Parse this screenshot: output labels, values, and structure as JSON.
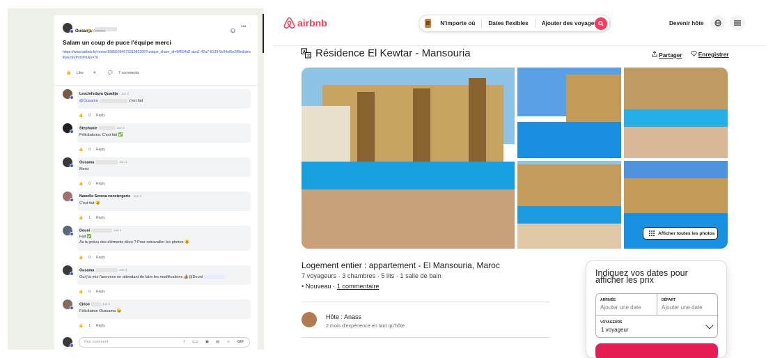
{
  "left": {
    "post": {
      "author": "Ousama",
      "date": "Jan 2 ·",
      "badge": "🏆 Victoires",
      "title": "Salam un coup de puce l'équipe merci",
      "link": "https://www.airbnb.fr/rooms/1685509467331982205?unique_share_id=5ff594d2-aba1-42a7-8139-9c94ef5e289e&viralityEntryPoint=1&s=76",
      "like_label": "Like",
      "like_count": "4",
      "comments_label": "7 comments"
    },
    "comments": [
      {
        "name": "Lesclefsdaya Quadija",
        "date": "· Jun 2",
        "text": "@Ousama",
        "text_after": "c'est fait",
        "likes": "0",
        "reply": "Reply"
      },
      {
        "name": "Stephanie",
        "date": "Jun 3",
        "text": "Félicitations: C'est fait ✅",
        "likes": "0",
        "reply": "Reply"
      },
      {
        "name": "Ousama",
        "date": "Jun 3",
        "text": "Merci",
        "likes": "0",
        "reply": "Reply"
      },
      {
        "name": "Nawelle Serena conciergerie",
        "date": "· Jun 3",
        "text": "C'est fait 😉",
        "likes": "1",
        "reply": "Reply"
      },
      {
        "name": "Douni",
        "date": "Jun 4",
        "text": "Fait ✅",
        "text2": "As tu prévu des éléments déco ? Pour retravailler les photos 😉",
        "likes": "0",
        "reply": "Reply"
      },
      {
        "name": "Ousama",
        "date": "Jun 4",
        "text": "Oui j'ai mis l'annonce en attendant de faire les modifications 👍🏽@Douni",
        "likes": "0",
        "reply": "Reply"
      },
      {
        "name": "Chloé",
        "date": "Jun 5",
        "text": "Félicitation Oussama 😉",
        "likes": "1",
        "reply": "Reply"
      }
    ],
    "comment_placeholder": "Your comment",
    "gif_label": "GIF"
  },
  "header": {
    "brand": "airbnb",
    "search": {
      "where": "N'importe où",
      "when": "Dates flexibles",
      "who": "Ajouter des voyageurs"
    },
    "host_link": "Devenir hôte"
  },
  "listing": {
    "title": "Résidence El Kewtar - Mansouria",
    "share": "Partager",
    "save": "Enregistrer",
    "show_all_photos": "Afficher toutes les photos",
    "heading": "Logement entier : appartement - El Mansouria, Maroc",
    "details": "7 voyageurs · 3 chambres · 5 lits · 1 salle de bain",
    "new_label": "• Nouveau ·",
    "comment_link": "1 commentaire",
    "host_name": "Hôte : Anass",
    "host_exp": "2 mois d'expérience en tant qu'hôte"
  },
  "booking": {
    "title": "Indiquez vos dates pour afficher les prix",
    "arrival_label": "ARRIVÉE",
    "arrival_value": "Ajouter une date",
    "departure_label": "DÉPART",
    "departure_value": "Ajouter une date",
    "guests_label": "VOYAGEURS",
    "guests_value": "1 voyageur"
  },
  "colors": {
    "brand": "#ff385c",
    "link": "#3552d6"
  },
  "icons": [
    "airbnb-logo-icon",
    "search-icon",
    "globe-icon",
    "menu-icon",
    "translate-icon",
    "share-icon",
    "heart-icon",
    "grid-icon",
    "chevron-down-icon",
    "like-icon",
    "comment-icon",
    "bell-icon",
    "more-icon"
  ]
}
